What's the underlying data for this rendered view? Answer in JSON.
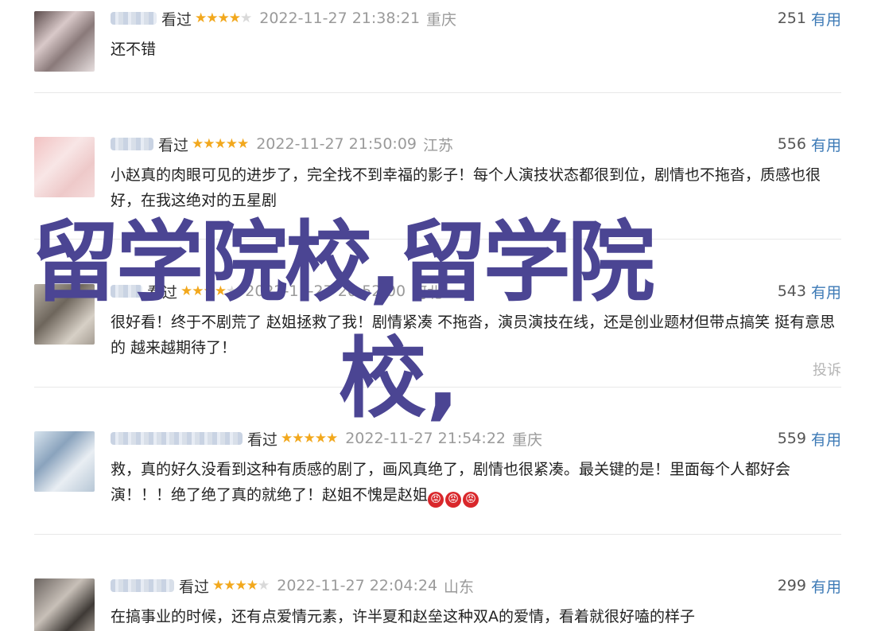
{
  "comments": [
    {
      "status": "看过",
      "stars": "★★★★",
      "stars_off": "★",
      "time": "2022-11-27 21:38:21",
      "location": "重庆",
      "votes": "251",
      "useful_label": "有用",
      "text": "还不错"
    },
    {
      "status": "看过",
      "stars": "★★★★★",
      "stars_off": "",
      "time": "2022-11-27 21:50:09",
      "location": "江苏",
      "votes": "556",
      "useful_label": "有用",
      "text": "小赵真的肉眼可见的进步了，完全找不到幸福的影子！每个人演技状态都很到位，剧情也不拖沓，质感也很好，在我这绝对的五星剧"
    },
    {
      "status": "看过",
      "stars": "★★★★",
      "stars_off": "★",
      "time": "2022-11-27 20:52:00",
      "location": "河北",
      "votes": "543",
      "useful_label": "有用",
      "text": "很好看！终于不剧荒了 赵姐拯救了我！剧情紧凑 不拖沓，演员演技在线，还是创业题材但带点搞笑 挺有意思的 越来越期待了！",
      "report": "投诉"
    },
    {
      "status": "看过",
      "stars": "★★★★★",
      "stars_off": "",
      "time": "2022-11-27 21:54:22",
      "location": "重庆",
      "votes": "559",
      "useful_label": "有用",
      "text": "救，真的好久没看到这种有质感的剧了，画风真绝了，剧情也很紧凑。最关键的是！里面每个人都好会演！！！绝了绝了真的就绝了！赵姐不愧是赵姐"
    },
    {
      "status": "看过",
      "stars": "★★★★",
      "stars_off": "★",
      "time": "2022-11-27 22:04:24",
      "location": "山东",
      "votes": "299",
      "useful_label": "有用",
      "text": "在搞事业的时候，还有点爱情元素，许半夏和赵垒这种双A的爱情，看着就很好嗑的样子"
    }
  ],
  "emoji_icon": "angry-face-icon",
  "emoji_glyph": "😡",
  "watermark": {
    "line1": "留学院校,留学院",
    "line2": "校,"
  },
  "colors": {
    "star": "#f2a81d",
    "useful": "#3d7ab6",
    "watermark": "#4b4593"
  }
}
